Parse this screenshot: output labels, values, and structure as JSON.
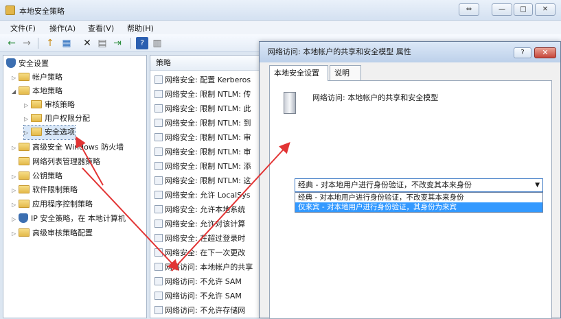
{
  "window": {
    "title": "本地安全策略",
    "controls": [
      "⇔",
      "—",
      "□",
      "✕"
    ]
  },
  "menu": [
    "文件(F)",
    "操作(A)",
    "查看(V)",
    "帮助(H)"
  ],
  "toolbar": [
    "←",
    "→",
    "↑",
    "▦",
    "✕",
    "▤",
    "⇥",
    "?",
    "▥"
  ],
  "tree": [
    {
      "label": "安全设置",
      "level": 0,
      "icon": "shield"
    },
    {
      "label": "帐户策略",
      "level": 1,
      "icon": "folder",
      "arrow": "▷"
    },
    {
      "label": "本地策略",
      "level": 1,
      "icon": "folder",
      "arrow": "◢"
    },
    {
      "label": "审核策略",
      "level": 2,
      "icon": "folder",
      "arrow": "▷"
    },
    {
      "label": "用户权限分配",
      "level": 2,
      "icon": "folder",
      "arrow": "▷"
    },
    {
      "label": "安全选项",
      "level": 2,
      "icon": "folder",
      "arrow": "▷",
      "selected": true
    },
    {
      "label": "高级安全 Windows 防火墙",
      "level": 1,
      "icon": "folder",
      "arrow": "▷"
    },
    {
      "label": "网络列表管理器策略",
      "level": 1,
      "icon": "folder"
    },
    {
      "label": "公钥策略",
      "level": 1,
      "icon": "folder",
      "arrow": "▷"
    },
    {
      "label": "软件限制策略",
      "level": 1,
      "icon": "folder",
      "arrow": "▷"
    },
    {
      "label": "应用程序控制策略",
      "level": 1,
      "icon": "folder",
      "arrow": "▷"
    },
    {
      "label": "IP 安全策略，在 本地计算机",
      "level": 1,
      "icon": "shield",
      "arrow": "▷"
    },
    {
      "label": "高级审核策略配置",
      "level": 1,
      "icon": "folder",
      "arrow": "▷"
    }
  ],
  "policy_list": {
    "header": "策略",
    "rows": [
      "网络安全: 配置 Kerberos",
      "网络安全: 限制 NTLM: 传",
      "网络安全: 限制 NTLM: 此",
      "网络安全: 限制 NTLM: 到",
      "网络安全: 限制 NTLM: 审",
      "网络安全: 限制 NTLM: 审",
      "网络安全: 限制 NTLM: 添",
      "网络安全: 限制 NTLM: 这",
      "网络安全: 允许 LocalSys",
      "网络安全: 允许本地系统",
      "网络安全: 允许对该计算",
      "网络安全: 在超过登录时",
      "网络安全: 在下一次更改",
      "网络访问: 本地帐户的共享",
      "网络访问: 不允许 SAM",
      "网络访问: 不允许 SAM",
      "网络访问: 不允许存储网"
    ]
  },
  "dialog": {
    "title": "网络访问: 本地帐户的共享和安全模型 属性",
    "help": "?",
    "close": "✕",
    "tabs": [
      "本地安全设置",
      "说明"
    ],
    "policy_name": "网络访问: 本地帐户的共享和安全模型",
    "combo_value": "经典 - 对本地用户进行身份验证，不改变其本来身份",
    "options": [
      "经典 - 对本地用户进行身份验证，不改变其本来身份",
      "仅来宾 - 对本地用户进行身份验证，其身份为来宾"
    ]
  }
}
